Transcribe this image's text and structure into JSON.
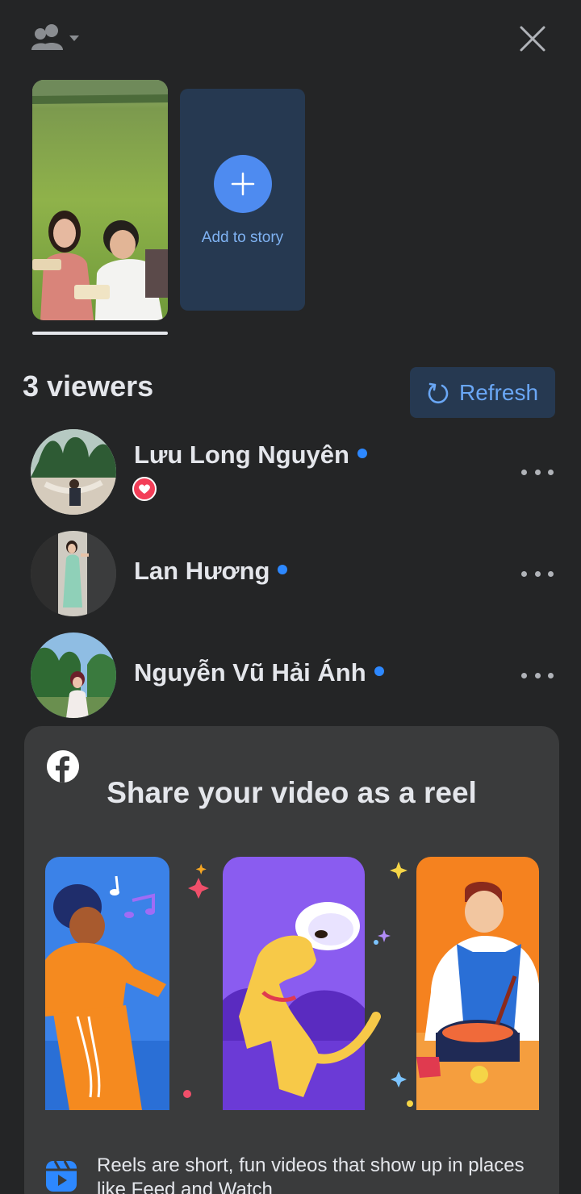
{
  "header": {
    "audience_icon": "people-icon",
    "close_icon": "close-icon"
  },
  "stories": {
    "add_label": "Add to story"
  },
  "viewers": {
    "title": "3 viewers",
    "refresh_label": "Refresh",
    "list": [
      {
        "name": "Lưu Long Nguyên",
        "online": true,
        "reaction": "love"
      },
      {
        "name": "Lan Hương",
        "online": true,
        "reaction": null
      },
      {
        "name": "Nguyễn Vũ Hải Ánh",
        "online": true,
        "reaction": null
      }
    ]
  },
  "reel_promo": {
    "brand_icon": "facebook-logo-icon",
    "title": "Share your video as a reel",
    "footer_icon": "reels-icon",
    "description": "Reels are short, fun videos that show up in places like Feed and Watch"
  },
  "colors": {
    "background": "#242526",
    "card": "#3a3b3c",
    "accent": "#2d88ff",
    "button_bg": "#263951",
    "love": "#f33e58"
  }
}
